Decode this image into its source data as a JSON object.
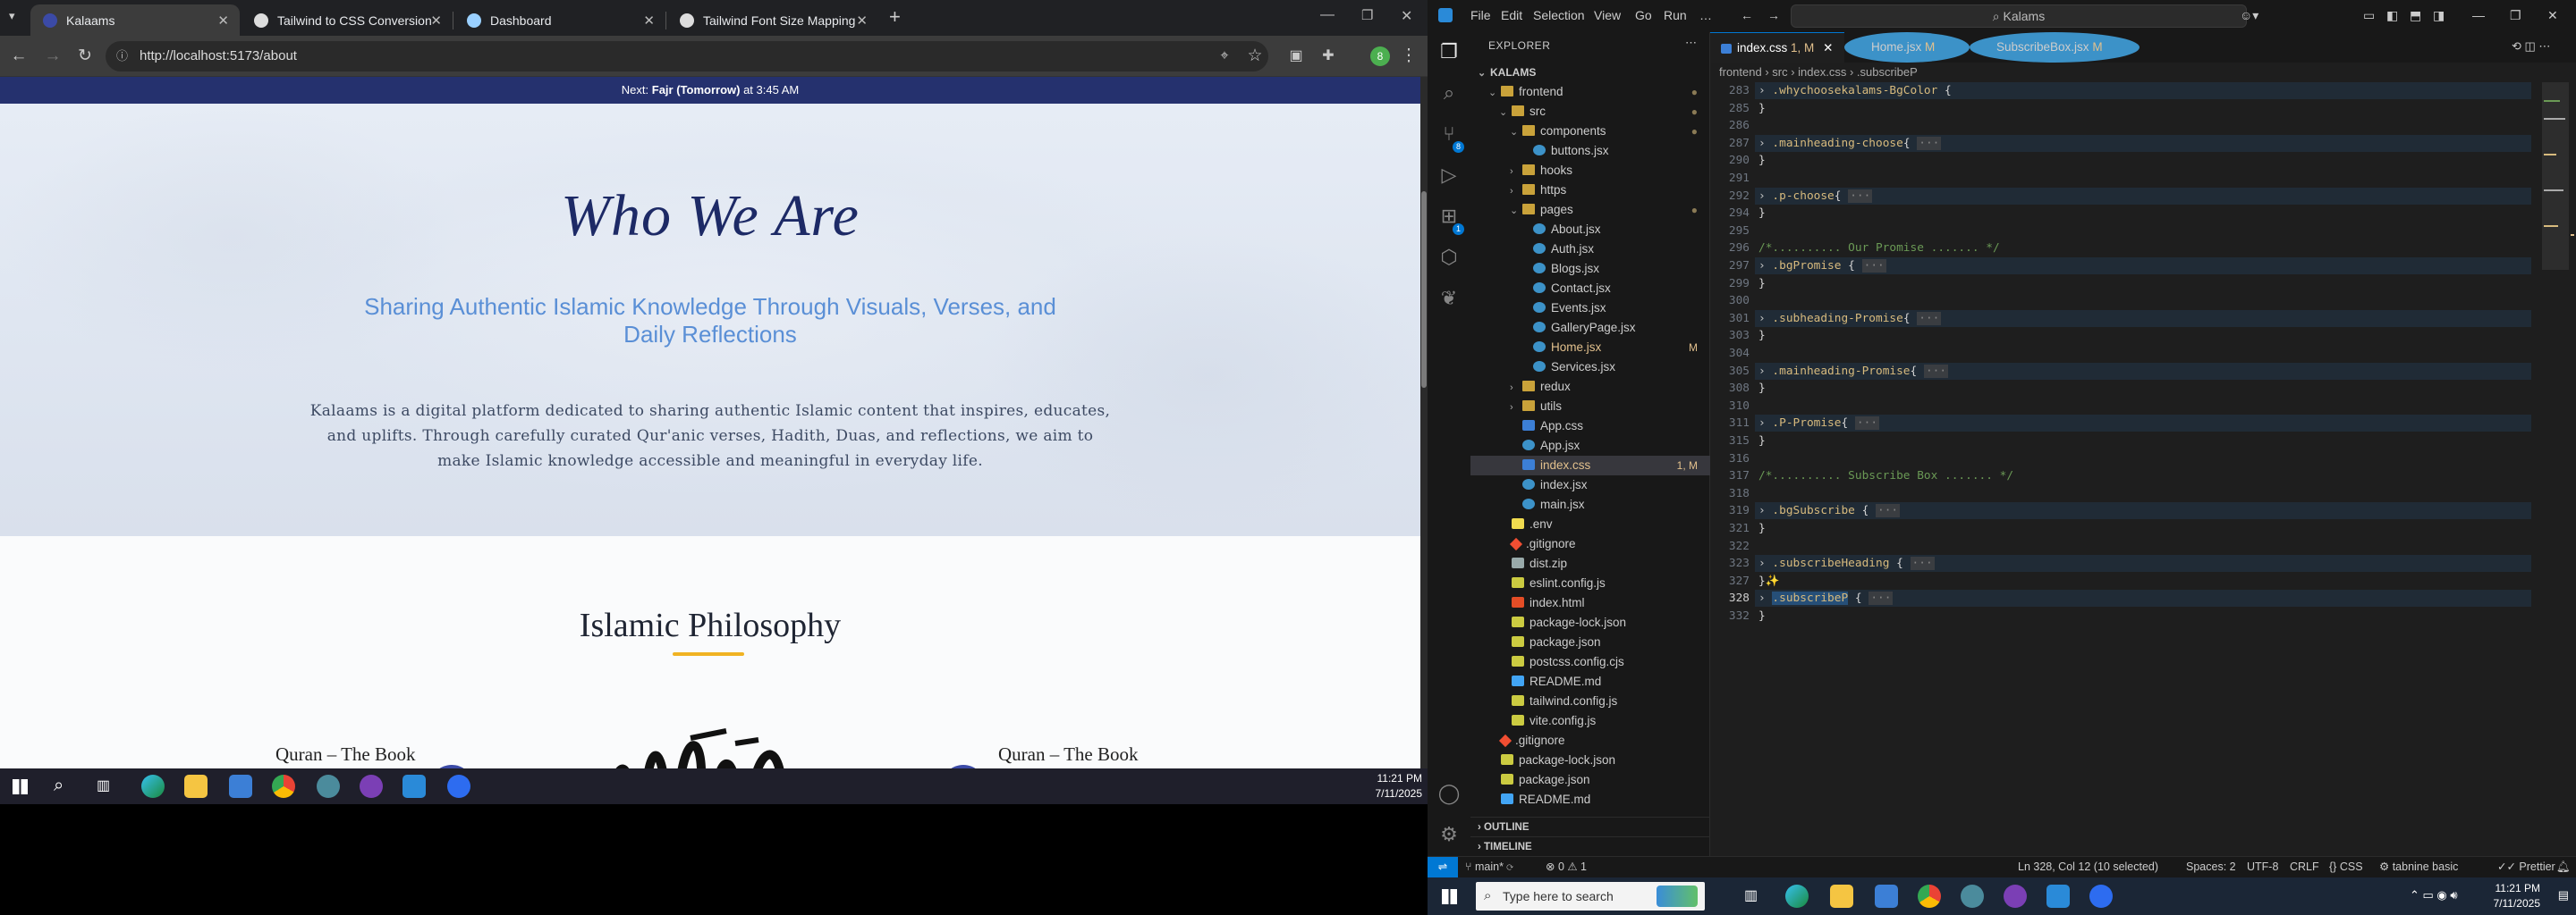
{
  "browser": {
    "tabs": [
      {
        "title": "Kalaams",
        "active": true
      },
      {
        "title": "Tailwind to CSS Conversion",
        "active": false
      },
      {
        "title": "Dashboard",
        "active": false
      },
      {
        "title": "Tailwind Font Size Mapping",
        "active": false
      }
    ],
    "url": "http://localhost:5173/about",
    "profile_initial": "8"
  },
  "site": {
    "notice_prefix": "Next: ",
    "notice_bold": "Fajr (Tomorrow)",
    "notice_suffix": " at 3:45 AM",
    "hero_title": "Who We Are",
    "hero_subtitle": "Sharing Authentic Islamic Knowledge Through Visuals, Verses, and Daily Reflections",
    "hero_body": "Kalaams is a digital platform dedicated to sharing authentic Islamic content that inspires, educates, and uplifts. Through carefully curated Qur'anic verses, Hadith, Duas, and reflections, we aim to make Islamic knowledge accessible and meaningful in everyday life.",
    "section_title": "Islamic Philosophy",
    "card_left_title": "Quran – The Book",
    "card_right_title": "Quran – The Book"
  },
  "taskbar_left": {
    "time": "11:21 PM",
    "date": "7/11/2025"
  },
  "vscode": {
    "menu": [
      "File",
      "Edit",
      "Selection",
      "View",
      "Go",
      "Run",
      "…"
    ],
    "command_center": "Kalams",
    "explorer_label": "EXPLORER",
    "root_folder": "KALAMS",
    "tree": [
      {
        "label": "frontend",
        "kind": "fold",
        "indent": 1,
        "open": true,
        "mod": "●"
      },
      {
        "label": "src",
        "kind": "fold",
        "indent": 2,
        "open": true,
        "mod": "●"
      },
      {
        "label": "components",
        "kind": "fold",
        "indent": 3,
        "open": true,
        "mod": "●"
      },
      {
        "label": "buttons.jsx",
        "kind": "jsx",
        "indent": 4
      },
      {
        "label": "hooks",
        "kind": "fold",
        "indent": 3,
        "open": false
      },
      {
        "label": "https",
        "kind": "fold",
        "indent": 3,
        "open": false
      },
      {
        "label": "pages",
        "kind": "fold",
        "indent": 3,
        "open": true,
        "mod": "●"
      },
      {
        "label": "About.jsx",
        "kind": "jsx",
        "indent": 4
      },
      {
        "label": "Auth.jsx",
        "kind": "jsx",
        "indent": 4
      },
      {
        "label": "Blogs.jsx",
        "kind": "jsx",
        "indent": 4
      },
      {
        "label": "Contact.jsx",
        "kind": "jsx",
        "indent": 4
      },
      {
        "label": "Events.jsx",
        "kind": "jsx",
        "indent": 4
      },
      {
        "label": "GalleryPage.jsx",
        "kind": "jsx",
        "indent": 4
      },
      {
        "label": "Home.jsx",
        "kind": "jsx",
        "indent": 4,
        "mod": "M"
      },
      {
        "label": "Services.jsx",
        "kind": "jsx",
        "indent": 4
      },
      {
        "label": "redux",
        "kind": "fold",
        "indent": 3,
        "open": false
      },
      {
        "label": "utils",
        "kind": "fold",
        "indent": 3,
        "open": false
      },
      {
        "label": "App.css",
        "kind": "css",
        "indent": 3
      },
      {
        "label": "App.jsx",
        "kind": "jsx",
        "indent": 3
      },
      {
        "label": "index.css",
        "kind": "css",
        "indent": 3,
        "mod": "1, M",
        "selected": true
      },
      {
        "label": "index.jsx",
        "kind": "jsx",
        "indent": 3
      },
      {
        "label": "main.jsx",
        "kind": "jsx",
        "indent": 3
      },
      {
        "label": ".env",
        "kind": "env",
        "indent": 2
      },
      {
        "label": ".gitignore",
        "kind": "git",
        "indent": 2
      },
      {
        "label": "dist.zip",
        "kind": "zip",
        "indent": 2
      },
      {
        "label": "eslint.config.js",
        "kind": "json",
        "indent": 2
      },
      {
        "label": "index.html",
        "kind": "html",
        "indent": 2
      },
      {
        "label": "package-lock.json",
        "kind": "json",
        "indent": 2
      },
      {
        "label": "package.json",
        "kind": "json",
        "indent": 2
      },
      {
        "label": "postcss.config.cjs",
        "kind": "json",
        "indent": 2
      },
      {
        "label": "README.md",
        "kind": "md",
        "indent": 2
      },
      {
        "label": "tailwind.config.js",
        "kind": "json",
        "indent": 2
      },
      {
        "label": "vite.config.js",
        "kind": "json",
        "indent": 2
      },
      {
        "label": ".gitignore",
        "kind": "git",
        "indent": 1
      },
      {
        "label": "package-lock.json",
        "kind": "json",
        "indent": 1
      },
      {
        "label": "package.json",
        "kind": "json",
        "indent": 1
      },
      {
        "label": "README.md",
        "kind": "md",
        "indent": 1
      }
    ],
    "outline_label": "OUTLINE",
    "timeline_label": "TIMELINE",
    "editor_tabs": [
      {
        "name": "index.css",
        "mod": "1, M",
        "active": true,
        "kind": "css"
      },
      {
        "name": "Home.jsx",
        "mod": "M",
        "active": false,
        "kind": "jsx"
      },
      {
        "name": "SubscribeBox.jsx",
        "mod": "M",
        "active": false,
        "kind": "jsx"
      }
    ],
    "breadcrumb": "frontend › src › index.css › .subscribeP",
    "code_lines": [
      {
        "n": "283",
        "sel": ".whychoosekalams-BgColor",
        "rest": " {",
        "fold": true,
        "cut": true
      },
      {
        "n": "285",
        "text": "}"
      },
      {
        "n": "286",
        "text": ""
      },
      {
        "n": "287",
        "sel": ".mainheading-choose",
        "rest": "{",
        "fold": true
      },
      {
        "n": "290",
        "text": "}"
      },
      {
        "n": "291",
        "text": ""
      },
      {
        "n": "292",
        "sel": ".p-choose",
        "rest": "{",
        "fold": true
      },
      {
        "n": "294",
        "text": "}"
      },
      {
        "n": "295",
        "text": ""
      },
      {
        "n": "296",
        "cmt": "/*.......... Our Promise ....... */"
      },
      {
        "n": "297",
        "sel": ".bgPromise",
        "rest": " {",
        "fold": true
      },
      {
        "n": "299",
        "text": "}"
      },
      {
        "n": "300",
        "text": ""
      },
      {
        "n": "301",
        "sel": ".subheading-Promise",
        "rest": "{",
        "fold": true
      },
      {
        "n": "303",
        "text": "}"
      },
      {
        "n": "304",
        "text": ""
      },
      {
        "n": "305",
        "sel": ".mainheading-Promise",
        "rest": "{",
        "fold": true
      },
      {
        "n": "308",
        "text": "}"
      },
      {
        "n": "310",
        "text": ""
      },
      {
        "n": "311",
        "sel": ".P-Promise",
        "rest": "{",
        "fold": true
      },
      {
        "n": "315",
        "text": "}"
      },
      {
        "n": "316",
        "text": ""
      },
      {
        "n": "317",
        "cmt": "/*.......... Subscribe Box ....... */"
      },
      {
        "n": "318",
        "text": ""
      },
      {
        "n": "319",
        "sel": ".bgSubscribe",
        "rest": " {",
        "fold": true
      },
      {
        "n": "321",
        "text": "}"
      },
      {
        "n": "322",
        "text": ""
      },
      {
        "n": "323",
        "sel": ".subscribeHeading",
        "rest": " {",
        "fold": true
      },
      {
        "n": "327",
        "text": "}✨"
      },
      {
        "n": "328",
        "sel": ".subscribeP",
        "rest": " {",
        "fold": true,
        "current": true
      },
      {
        "n": "332",
        "text": "}"
      }
    ],
    "status": {
      "branch": "main*",
      "problems": "⊗ 0 ⚠ 1",
      "position": "Ln 328, Col 12 (10 selected)",
      "spaces": "Spaces: 2",
      "encoding": "UTF-8",
      "eol": "CRLF",
      "language": "CSS",
      "tabnine": "tabnine basic",
      "prettier": "Prettier"
    }
  },
  "taskbar_right": {
    "search_placeholder": "Type here to search",
    "time": "11:21 PM",
    "date": "7/11/2025"
  },
  "colors": {
    "hero_title": "#1d2a66",
    "hero_subtitle": "#5a8fd6",
    "notice_bg": "#25316e",
    "accent_line": "#f0b323",
    "vscode_accent": "#0078d4"
  }
}
